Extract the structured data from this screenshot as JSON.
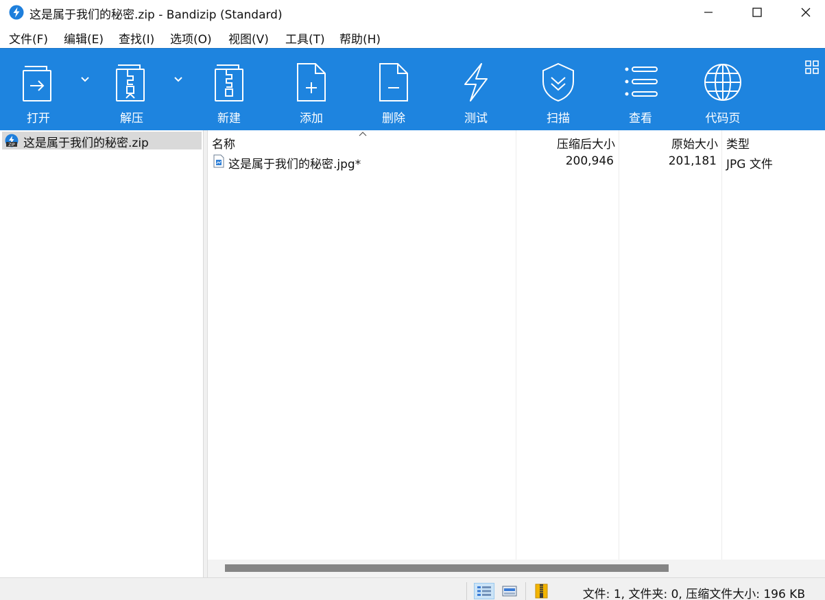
{
  "window": {
    "title": "这是属于我们的秘密.zip - Bandizip (Standard)",
    "app_icon": "bandizip-logo-icon",
    "controls": [
      "minimize-icon",
      "maximize-icon",
      "close-icon"
    ]
  },
  "menu": {
    "items": [
      {
        "label": "文件(F)"
      },
      {
        "label": "编辑(E)"
      },
      {
        "label": "查找(I)"
      },
      {
        "label": "选项(O)"
      },
      {
        "label": "视图(V)"
      },
      {
        "label": "工具(T)"
      },
      {
        "label": "帮助(H)"
      }
    ]
  },
  "toolbar": {
    "accent": "#1e84df",
    "buttons": [
      {
        "label": "打开",
        "icon": "open-archive-icon",
        "has_dropdown": true
      },
      {
        "label": "解压",
        "icon": "extract-icon",
        "has_dropdown": true
      },
      {
        "label": "新建",
        "icon": "new-archive-icon",
        "has_dropdown": false
      },
      {
        "label": "添加",
        "icon": "add-file-icon",
        "has_dropdown": false
      },
      {
        "label": "删除",
        "icon": "delete-file-icon",
        "has_dropdown": false
      },
      {
        "label": "测试",
        "icon": "test-lightning-icon",
        "has_dropdown": false
      },
      {
        "label": "扫描",
        "icon": "scan-shield-icon",
        "has_dropdown": false
      },
      {
        "label": "查看",
        "icon": "view-list-icon",
        "has_dropdown": false
      },
      {
        "label": "代码页",
        "icon": "codepage-globe-icon",
        "has_dropdown": false
      }
    ],
    "corner_icon": "layout-grid-icon"
  },
  "tree": {
    "items": [
      {
        "label": "这是属于我们的秘密.zip",
        "icon": "zip-archive-icon",
        "selected": true
      }
    ]
  },
  "filelist": {
    "columns": [
      {
        "label": "名称",
        "sorted": "ascending"
      },
      {
        "label": "压缩后大小"
      },
      {
        "label": "原始大小"
      },
      {
        "label": "类型"
      }
    ],
    "rows": [
      {
        "name": "这是属于我们的秘密.jpg*",
        "compressed": "200,946",
        "original": "201,181",
        "type": "JPG 文件",
        "icon": "jpg-file-icon"
      }
    ]
  },
  "statusbar": {
    "text": "文件: 1, 文件夹: 0, 压缩文件大小: 196 KB",
    "view_buttons": [
      "details-view-icon",
      "preview-view-icon",
      "archive-info-icon"
    ]
  }
}
